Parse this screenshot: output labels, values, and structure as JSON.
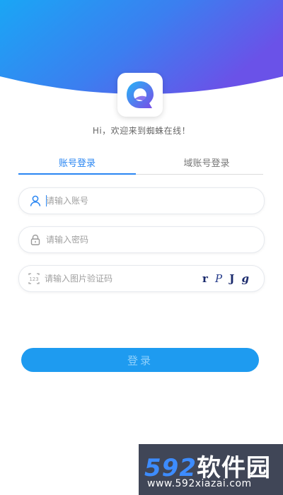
{
  "app": {
    "greeting": "Hi，欢迎来到蜘蛛在线！"
  },
  "tabs": [
    {
      "label": "账号登录",
      "active": true
    },
    {
      "label": "域账号登录",
      "active": false
    }
  ],
  "form": {
    "account": {
      "placeholder": "请输入账号",
      "value": ""
    },
    "password": {
      "placeholder": "请输入密码",
      "value": ""
    },
    "captcha": {
      "placeholder": "请输入图片验证码",
      "value": "",
      "chars": [
        "r",
        "P",
        "J",
        "g"
      ]
    }
  },
  "login_button": {
    "label": "登录"
  },
  "watermark": {
    "title_number": "592",
    "title_text": "软件园",
    "url": "www.592xiazai.com"
  },
  "colors": {
    "accent": "#2a86f2",
    "button": "#1e9bf0",
    "header_start": "#1aa6f5",
    "header_end": "#6a52e8"
  },
  "icons": [
    "app-logo-icon",
    "user-icon",
    "lock-icon",
    "captcha-icon"
  ]
}
